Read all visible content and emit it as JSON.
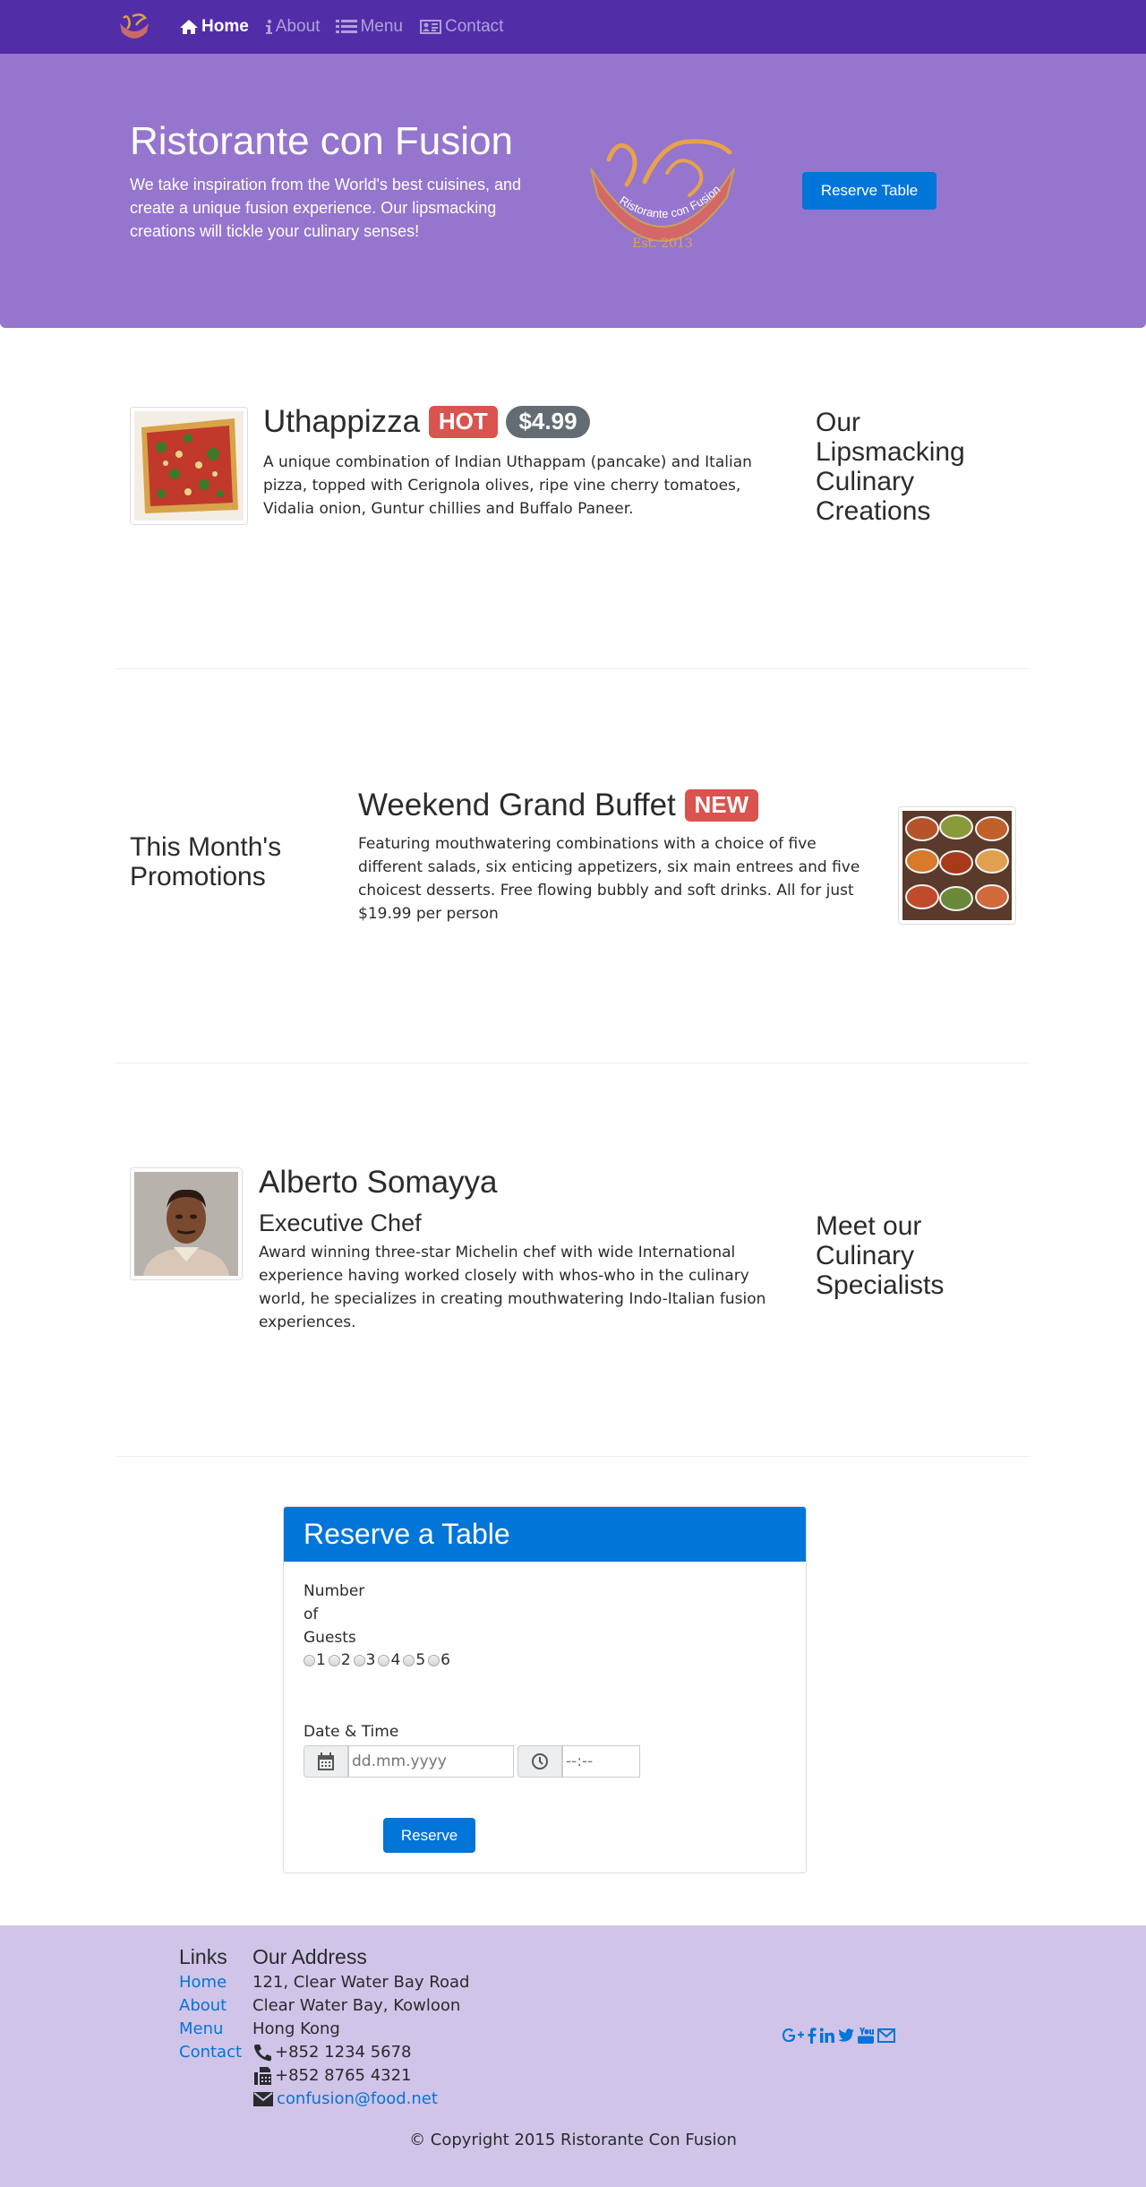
{
  "nav": {
    "items": [
      {
        "label": "Home",
        "icon": "home-icon"
      },
      {
        "label": "About",
        "icon": "info-icon"
      },
      {
        "label": "Menu",
        "icon": "list-icon"
      },
      {
        "label": "Contact",
        "icon": "address-card-icon"
      }
    ],
    "active": "Home"
  },
  "jumbotron": {
    "title": "Ristorante con Fusion",
    "text": "We take inspiration from the World's best cuisines, and create a unique fusion experience. Our lipsmacking creations will tickle your culinary senses!",
    "logo_ribbon_text": "Ristorante con Fusion",
    "logo_est": "Est. 2013",
    "reserve_button": "Reserve Table"
  },
  "dish": {
    "name": "Uthappizza",
    "badge": "HOT",
    "price": "$4.99",
    "description": "A unique combination of Indian Uthappam (pancake) and Italian pizza, topped with Cerignola olives, ripe vine cherry tomatoes, Vidalia onion, Guntur chillies and Buffalo Paneer.",
    "side_heading": "Our Lipsmacking Culinary Creations"
  },
  "promotion": {
    "side_heading": "This Month's Promotions",
    "name": "Weekend Grand Buffet",
    "badge": "NEW",
    "description": "Featuring mouthwatering combinations with a choice of five different salads, six enticing appetizers, six main entrees and five choicest desserts. Free flowing bubbly and soft drinks. All for just $19.99 per person"
  },
  "leader": {
    "name": "Alberto Somayya",
    "title": "Executive Chef",
    "description": "Award winning three-star Michelin chef with wide International experience having worked closely with whos-who in the culinary world, he specializes in creating mouthwatering Indo-Italian fusion experiences.",
    "side_heading": "Meet our Culinary Specialists"
  },
  "reserve": {
    "title": "Reserve a Table",
    "guests_label_1": "Number",
    "guests_label_2": "of",
    "guests_label_3": "Guests",
    "guest_options": [
      "1",
      "2",
      "3",
      "4",
      "5",
      "6"
    ],
    "datetime_label": "Date & Time",
    "date_placeholder": "dd.mm.yyyy",
    "time_placeholder": "--:--",
    "submit": "Reserve"
  },
  "footer": {
    "links_heading": "Links",
    "links": [
      "Home",
      "About",
      "Menu",
      "Contact"
    ],
    "address_heading": "Our Address",
    "address": [
      "121, Clear Water Bay Road",
      "Clear Water Bay, Kowloon",
      "Hong Kong"
    ],
    "phone": "+852 1234 5678",
    "fax": "+852 8765 4321",
    "email": "confusion@food.net",
    "social": [
      "google-plus-icon",
      "facebook-icon",
      "linkedin-icon",
      "twitter-icon",
      "youtube-icon",
      "envelope-icon"
    ],
    "copyright": "© Copyright 2015 Ristorante Con Fusion"
  },
  "colors": {
    "navbar": "#512da8",
    "jumbotron": "#9575cd",
    "footer": "#d1c4e9",
    "primary": "#0275d8",
    "danger": "#d9534f",
    "pill": "#636c72"
  }
}
